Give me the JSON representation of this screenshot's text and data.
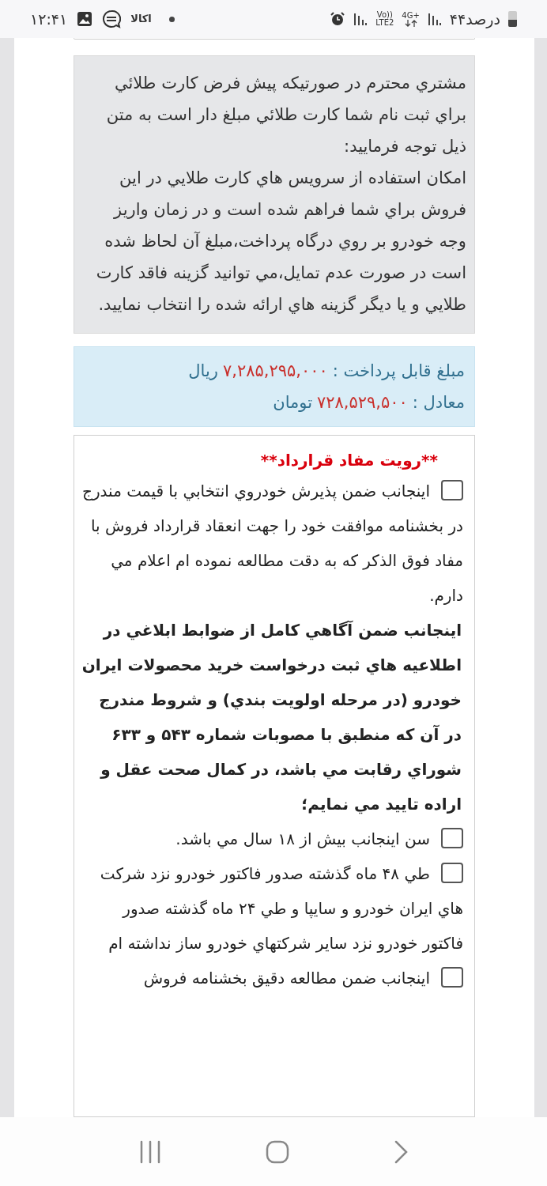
{
  "status_bar": {
    "time": "۱۲:۴۱",
    "app_label": "اکالا",
    "network_top": "4G+",
    "volte_top": "Vo))",
    "volte_bottom": "LTE2",
    "battery_text": "۴۴درصد"
  },
  "notice": {
    "paragraphs": [
      "مشتري محترم در صورتيكه پيش فرض كارت طلائي براي ثبت نام شما كارت طلائي مبلغ دار است به متن ذيل توجه فرماييد:",
      "امكان استفاده از سرويس هاي كارت طلايي در اين فروش براي شما فراهم شده است و در زمان واريز وجه خودرو بر روي درگاه پرداخت،مبلغ آن لحاظ شده است در صورت عدم تمايل،مي توانيد گزينه فاقد كارت طلايي و يا ديگر گزينه هاي ارائه شده را انتخاب نماييد."
    ]
  },
  "payment": {
    "rows": [
      {
        "label": "مبلغ قابل پرداخت :",
        "amount": "۷,۲۸۵,۲۹۵,۰۰۰",
        "unit": "ريال"
      },
      {
        "label": "معادل :",
        "amount": "۷۲۸,۵۲۹,۵۰۰",
        "unit": "تومان"
      }
    ]
  },
  "contract": {
    "title": "**رويت مفاد قرارداد**",
    "items": [
      {
        "kind": "checkbox",
        "checked": false,
        "text": "اينجانب ضمن پذيرش خودروي انتخابي با قيمت مندرج در بخشنامه موافقت خود را جهت انعقاد قرارداد فروش با مفاد فوق الذكر كه به دقت مطالعه نموده ام اعلام مي دارم."
      },
      {
        "kind": "statement",
        "text": "اينجانب ضمن آگاهي كامل از ضوابط ابلاغي در اطلاعيه هاي ثبت درخواست خريد محصولات ايران خودرو (در مرحله اولويت بندي) و شروط مندرج در آن كه منطبق با مصوبات شماره ۵۴۳ و ۶۳۳ شوراي رقابت مي باشد، در كمال صحت عقل و اراده تاييد مي نمايم؛"
      },
      {
        "kind": "checkbox",
        "checked": false,
        "text": "سن اينجانب بيش از ۱۸ سال مي باشد."
      },
      {
        "kind": "checkbox",
        "checked": false,
        "text": "طي ۴۸ ماه گذشته صدور فاكتور خودرو نزد شركت هاي ايران خودرو و سايپا و طي ۲۴ ماه گذشته صدور فاكتور خودرو نزد ساير شركتهاي خودرو ساز نداشته ام"
      },
      {
        "kind": "checkbox",
        "checked": false,
        "text": "اينجانب ضمن مطالعه دقيق بخشنامه فروش"
      }
    ]
  }
}
